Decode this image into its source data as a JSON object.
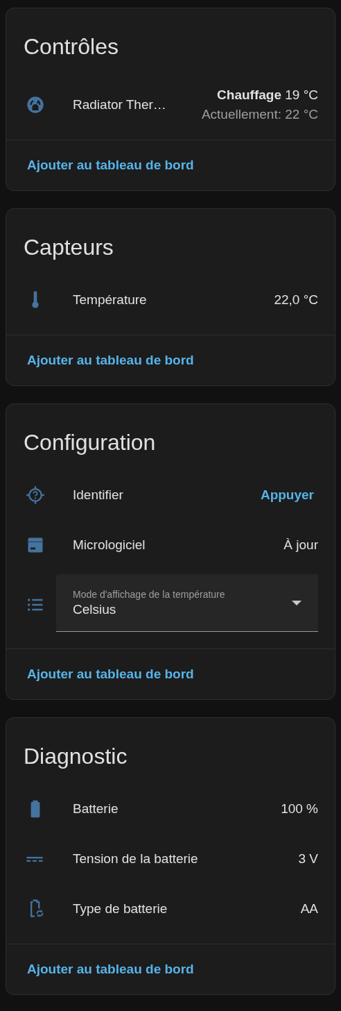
{
  "cards": [
    {
      "title": "Contrôles",
      "rows": [
        {
          "kind": "climate",
          "name": "Radiator Ther…",
          "mode": "Chauffage",
          "target": " 19 °C",
          "current": "Actuellement: 22 °C"
        }
      ],
      "footer": "Ajouter au tableau de bord"
    },
    {
      "title": "Capteurs",
      "rows": [
        {
          "kind": "state",
          "name": "Température",
          "value": "22,0 °C"
        }
      ],
      "footer": "Ajouter au tableau de bord"
    },
    {
      "title": "Configuration",
      "rows": [
        {
          "kind": "button",
          "name": "Identifier",
          "action": "Appuyer"
        },
        {
          "kind": "state",
          "name": "Micrologiciel",
          "value": "À jour"
        },
        {
          "kind": "select",
          "label": "Mode d'affichage de la température",
          "value": "Celsius"
        }
      ],
      "footer": "Ajouter au tableau de bord"
    },
    {
      "title": "Diagnostic",
      "rows": [
        {
          "kind": "state",
          "name": "Batterie",
          "value": "100 %"
        },
        {
          "kind": "state",
          "name": "Tension de la batterie",
          "value": "3 V"
        },
        {
          "kind": "state",
          "name": "Type de batterie",
          "value": "AA"
        }
      ],
      "footer": "Ajouter au tableau de bord"
    }
  ]
}
